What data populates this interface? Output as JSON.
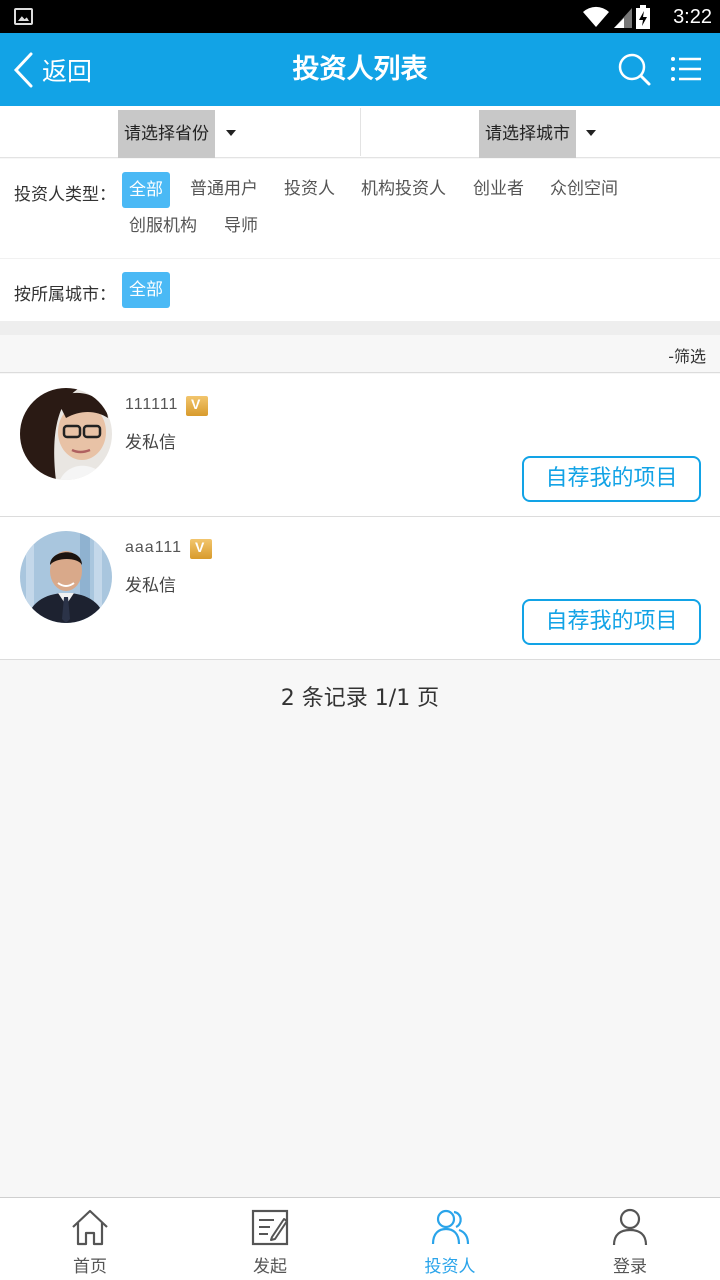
{
  "status_bar": {
    "time": "3:22"
  },
  "header": {
    "back_label": "返回",
    "title": "投资人列表"
  },
  "selectors": {
    "province": "请选择省份",
    "city": "请选择城市"
  },
  "filters": {
    "type_label": "投资人类型：",
    "type_options": [
      "全部",
      "普通用户",
      "投资人",
      "机构投资人",
      "创业者",
      "众创空间",
      "创服机构",
      "导师"
    ],
    "selected_type": "全部",
    "city_label": "按所属城市：",
    "city_options": [
      "全部"
    ]
  },
  "filter_toggle": "-筛选",
  "investors": [
    {
      "name": "111111",
      "message_link": "发私信",
      "action_label": "自荐我的项目"
    },
    {
      "name": "aaa111",
      "message_link": "发私信",
      "action_label": "自荐我的项目"
    }
  ],
  "pagination": "2 条记录 1/1 页",
  "bottom_nav": [
    {
      "label": "首页",
      "icon": "home-icon"
    },
    {
      "label": "发起",
      "icon": "edit-icon"
    },
    {
      "label": "投资人",
      "icon": "users-icon"
    },
    {
      "label": "登录",
      "icon": "user-icon"
    }
  ],
  "colors": {
    "primary": "#12a3e6",
    "chip_active": "#4ab9f5",
    "nav_active": "#2aa4ea"
  }
}
